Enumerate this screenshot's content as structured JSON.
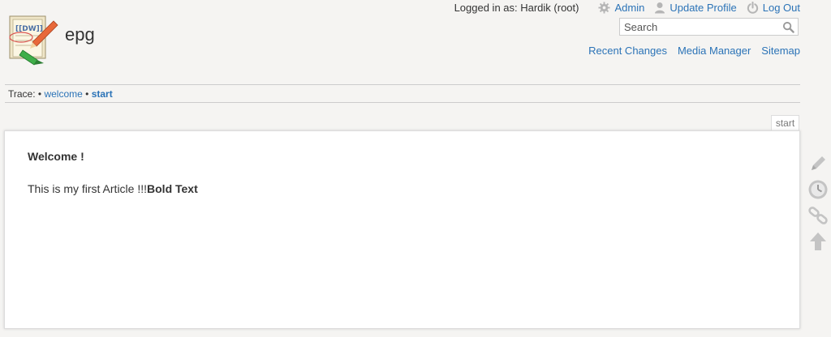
{
  "site": {
    "title": "epg"
  },
  "user": {
    "logged_in_text": "Logged in as: Hardik (root)",
    "admin_label": "Admin",
    "update_profile_label": "Update Profile",
    "logout_label": "Log Out"
  },
  "search": {
    "placeholder": "Search"
  },
  "site_tools": {
    "recent_changes": "Recent Changes",
    "media_manager": "Media Manager",
    "sitemap": "Sitemap"
  },
  "breadcrumbs": {
    "label": "Trace:",
    "separator": "•",
    "items": [
      "welcome",
      "start"
    ]
  },
  "page": {
    "id": "start",
    "heading": "Welcome !",
    "text": "This is my first Article !!!",
    "bold_text": "Bold Text"
  },
  "page_tools": [
    "edit-icon",
    "clock-icon",
    "link-icon",
    "arrow-up-icon"
  ],
  "colors": {
    "link": "#2b73b7",
    "background": "#f5f4f2",
    "icon_gray": "#bbbbbb"
  }
}
